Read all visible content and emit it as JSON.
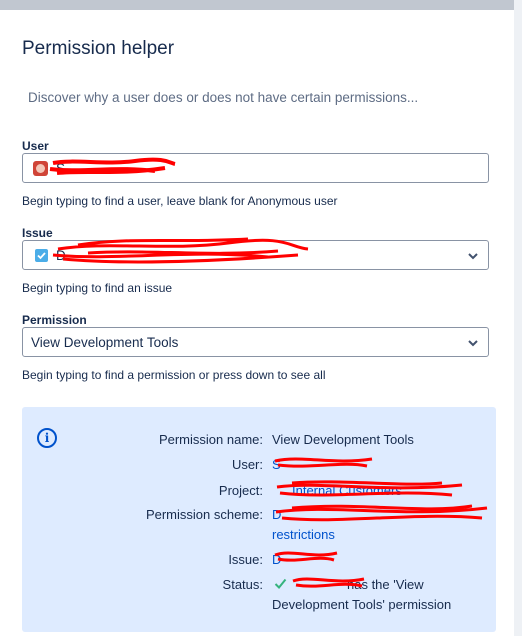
{
  "page": {
    "title": "Permission helper",
    "description": "Discover why a user does or does not have certain permissions..."
  },
  "user_field": {
    "label": "User",
    "value": "S",
    "help": "Begin typing to find a user, leave blank for Anonymous user"
  },
  "issue_field": {
    "label": "Issue",
    "value": "D",
    "help": "Begin typing to find an issue"
  },
  "permission_field": {
    "label": "Permission",
    "value": "View Development Tools",
    "help": "Begin typing to find a permission or press down to see all"
  },
  "result": {
    "rows": [
      {
        "label": "Permission name:",
        "value": "View Development Tools"
      },
      {
        "label": "User:",
        "value": "S"
      },
      {
        "label": "Project:",
        "value": "Internal Customers"
      },
      {
        "label": "Permission scheme:",
        "value": "D",
        "value2": "restrictions"
      },
      {
        "label": "Issue:",
        "value": "D"
      },
      {
        "label": "Status:",
        "value": "has the 'View",
        "value2": "Development Tools' permission"
      }
    ]
  },
  "icons": {
    "avatar": "user-avatar-icon",
    "issue_type": "task-checkbox-icon",
    "dropdown": "chevron-down-icon",
    "info": "info-icon",
    "status": "green-checkmark-icon"
  },
  "colors": {
    "panel_bg": "#deebff",
    "link": "#0052cc",
    "check": "#36b37e",
    "redaction": "#ff0000"
  }
}
